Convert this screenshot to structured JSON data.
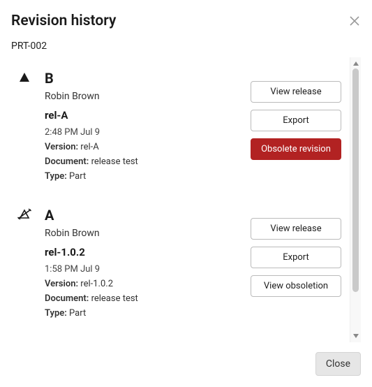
{
  "dialog": {
    "title": "Revision history",
    "subtitle": "PRT-002",
    "close_label": "Close"
  },
  "labels": {
    "version": "Version:",
    "document": "Document:",
    "type": "Type:"
  },
  "revisions": [
    {
      "icon": "triangle-icon",
      "letter": "B",
      "author": "Robin Brown",
      "release": "rel-A",
      "timestamp": "2:48 PM Jul 9",
      "version": "rel-A",
      "document": "release test",
      "type": "Part",
      "actions": {
        "view_release": "View release",
        "export": "Export",
        "third": "Obsolete revision",
        "third_kind": "danger"
      }
    },
    {
      "icon": "struck-triangle-icon",
      "letter": "A",
      "author": "Robin Brown",
      "release": "rel-1.0.2",
      "timestamp": "1:58 PM Jul 9",
      "version": "rel-1.0.2",
      "document": "release test",
      "type": "Part",
      "actions": {
        "view_release": "View release",
        "export": "Export",
        "third": "View obsoletion",
        "third_kind": "normal"
      }
    }
  ]
}
